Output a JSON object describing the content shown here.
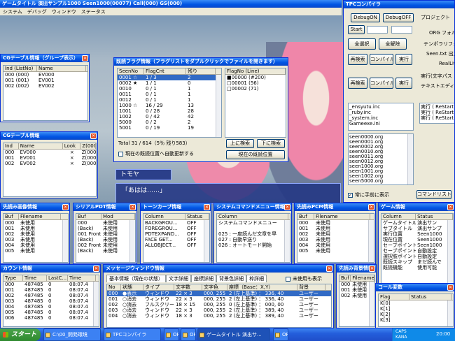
{
  "game": {
    "title": "ゲームタイトル 演出サンプル1000 Seen1000(00077) Call(000) GS(000)",
    "menu": [
      "システム",
      "デバッグ",
      "ウィンドウ",
      "ステータス"
    ],
    "dialog_name": "トモヤ",
    "dialog_text": "「あはは……」"
  },
  "cg_group": {
    "title": "CGテーブル情報（グループ表示）",
    "cols": [
      "Ind (ListNo)",
      "Name"
    ],
    "rows": [
      [
        "000 (000)",
        "EV000"
      ],
      [
        "001 (001)",
        "EV001"
      ],
      [
        "002 (002)",
        "EV002"
      ]
    ]
  },
  "cg_table": {
    "title": "CGテーブル情報",
    "cols": [
      "Ind",
      "Name",
      "Look",
      "Z(000"
    ],
    "rows": [
      [
        "000",
        "EV000",
        "×",
        "Z(000"
      ],
      [
        "001",
        "EV001",
        "×",
        "Z(000"
      ],
      [
        "002",
        "EV002",
        "×",
        "Z(000"
      ]
    ]
  },
  "flag": {
    "title": "既読フラグ情報（フラグリストをダブルクリックでファイルを開きます）",
    "cols": [
      "SeenNo",
      "FlagCnt",
      "残り"
    ],
    "rows": [
      [
        "0001 ☆",
        "1 / 3",
        "2"
      ],
      [
        "0002 ★",
        "1 / 1",
        "0"
      ],
      [
        "0010",
        "0 / 1",
        "1"
      ],
      [
        "0011",
        "0 / 1",
        "1"
      ],
      [
        "0012",
        "0 / 1",
        "1"
      ],
      [
        "1000 ☆",
        "16 / 29",
        "13"
      ],
      [
        "1001",
        "0 / 28",
        "28"
      ],
      [
        "1002",
        "0 / 42",
        "42"
      ],
      [
        "5000",
        "0 / 2",
        "2"
      ],
      [
        "5001",
        "0 / 19",
        "19"
      ]
    ],
    "right_cols": [
      "FlagNo (Line)"
    ],
    "right_rows": [
      "■00000 (#200)",
      "□00001 (56)",
      "□00002 (71)"
    ],
    "total": "Total 31 / 614（5％ 残り583）",
    "btn_up": "上に検索",
    "btn_down": "下に検索",
    "check_label": "現在の既読位置へ自動更新する",
    "btn_current": "現在の既読位置"
  },
  "tpc": {
    "title": "TPCコンパイラ",
    "btn_debug_on": "DebugON",
    "btn_debug_off": "DebugOFF",
    "btn_start": "Start",
    "btn_all_select": "全選択",
    "btn_all_clear": "全解除",
    "btn_research": "再検索",
    "btn_compile": "コンパイル",
    "btn_run": "実行",
    "btn_research2": "再検索",
    "btn_compile2": "コンパイル",
    "btn_run2": "実行",
    "inc_files": [
      "_ensyutu.inc",
      "_ruby.inc",
      "_system.inc",
      "Gameexe.ini"
    ],
    "seen_files": [
      "seen0000.org",
      "seen0001.org",
      "seen0002.org",
      "seen0010.org",
      "seen0011.org",
      "seen0012.org",
      "seen1000.org",
      "seen1001.org",
      "seen1002.org",
      "seen5000.org"
    ],
    "right_labels": [
      "プロジェクト",
      "ORG フォルダ",
      "テンポラリフォルダ",
      "Seen.txt 出力先",
      "RealLive.exe",
      "実行(文字パス",
      "テキストエディタ"
    ],
    "right_list": [
      "実行 ( ReStart",
      "実行 ( ReStart",
      "実行 ( ReStart"
    ],
    "check_top": "常に手前に表示",
    "btn_command": "コマンドリスト"
  },
  "yomi_img": {
    "title": "先読み画像情報",
    "cols": [
      "Buf",
      "Filename"
    ],
    "rows": [
      [
        "000",
        "未使用"
      ],
      [
        "001",
        "未使用"
      ],
      [
        "002",
        "未使用"
      ],
      [
        "003",
        "未使用"
      ],
      [
        "004",
        "未使用"
      ],
      [
        "005",
        "未使用"
      ]
    ]
  },
  "serial": {
    "title": "シリアルPDT情報",
    "cols": [
      "Buf",
      "Mod"
    ],
    "rows": [
      [
        "000",
        "未使用"
      ],
      [
        "(Back)",
        "未使用"
      ],
      [
        "001 Front",
        "未使用"
      ],
      [
        "(Back)",
        "未使用"
      ],
      [
        "002 Front",
        "未使用"
      ],
      [
        "(Back)",
        "未使用"
      ]
    ]
  },
  "token": {
    "title": "トーンカーブ情報",
    "cols": [
      "Column",
      "Status"
    ],
    "rows": [
      [
        "BACKGROU...",
        "OFF"
      ],
      [
        "FOREGROU...",
        "OFF"
      ],
      [
        "PDTEXPAND...",
        "OFF"
      ],
      [
        "FACE GET...",
        "OFF"
      ],
      [
        "ALLOBJECT...",
        "OFF"
      ]
    ]
  },
  "syscmd": {
    "title": "システムコマンドメニュー情報",
    "cols": [
      "Column"
    ],
    "rows": [
      "システムコマンドメニュー",
      "",
      "025 : 一度読んだ文章を早",
      "027 : 自動早送り",
      "026 : オートモード開始"
    ]
  },
  "yomi_pcm": {
    "title": "先読みPCM情報",
    "cols": [
      "Buf",
      "Filename"
    ],
    "rows": [
      [
        "000",
        "未使用"
      ],
      [
        "001",
        "未使用"
      ],
      [
        "002",
        "未使用"
      ],
      [
        "003",
        "未使用"
      ],
      [
        "004",
        "未使用"
      ],
      [
        "005",
        "未使用"
      ]
    ]
  },
  "gameinfo": {
    "title": "ゲーム情報",
    "cols": [
      "Column",
      "Status"
    ],
    "rows": [
      [
        "ゲームタイトル",
        "演出サン"
      ],
      [
        "サブタイトル",
        "演出サンプ"
      ],
      [
        "実行位置",
        "Seen1000"
      ],
      [
        "現在位置",
        "Seen1000"
      ],
      [
        "セーブポイント",
        "Seen1000"
      ],
      [
        "セーブポイントモード",
        "自動設定"
      ],
      [
        "選択肢ポイントモード",
        "自動設定"
      ],
      [
        "既読スキップ",
        "まだ読んで"
      ],
      [
        "既読機能",
        "使用可能"
      ]
    ]
  },
  "count": {
    "title": "カウント情報",
    "cols": [
      "Type",
      "Time",
      "LastC...",
      "Time"
    ],
    "rows": [
      [
        "000",
        "487485",
        "0",
        "08:07.4"
      ],
      [
        "001",
        "487485",
        "0",
        "08:07.4"
      ],
      [
        "002",
        "487485",
        "0",
        "08:07.4"
      ],
      [
        "003",
        "487485",
        "0",
        "08:07.4"
      ],
      [
        "004",
        "487485",
        "0",
        "08:07.4"
      ],
      [
        "005",
        "487485",
        "0",
        "08:07.4"
      ],
      [
        "006",
        "487485",
        "0",
        "08:07.4"
      ]
    ]
  },
  "msgwin": {
    "title": "メッセージウィンドウ情報",
    "tabs": [
      "基本情報（現在の状態）",
      "文字詳細",
      "座標詳細",
      "背景色詳細",
      "枠詳細"
    ],
    "check": "未使用も表示",
    "cols": [
      "No",
      "状態",
      "タイプ",
      "文字数",
      "文字色",
      "座標（Base：X,Y）",
      "背景"
    ],
    "rows": [
      [
        "000",
        "●表示",
        "ウィンドウ",
        "22 × 3",
        "000, 255",
        "2 (左上基準) ： 336, 40",
        "ユーザー"
      ],
      [
        "001",
        "○消去",
        "ウィンドウ",
        "22 × 3",
        "000, 255",
        "2 (左上基準) ： 336, 40",
        "ユーザー"
      ],
      [
        "002",
        "○消去",
        "フルスクリーン",
        "18 × 15",
        "000, 255",
        "0 (左上基準) ： 000, 00",
        "ユーザー"
      ],
      [
        "003",
        "○消去",
        "ウィンドウ",
        "22 × 3",
        "000, 255",
        "2 (左上基準) ： 389, 40",
        "ユーザー"
      ],
      [
        "004",
        "○消去",
        "ウィンドウ",
        "18 × 3",
        "000, 255",
        "2 (左上基準) ： 389, 40",
        "ユーザー"
      ]
    ]
  },
  "yomi_bg": {
    "title": "先読み背景情報",
    "cols": [
      "Buf",
      "Filename"
    ],
    "rows": [
      [
        "000",
        "未使用"
      ],
      [
        "001",
        "未使用"
      ],
      [
        "002",
        "未使用"
      ]
    ]
  },
  "call": {
    "title": "コール変数",
    "cols": [
      "Flag",
      "Status"
    ],
    "rows": [
      [
        "K[0]",
        ""
      ],
      [
        "K[1]",
        ""
      ],
      [
        "K[2]",
        ""
      ],
      [
        "K[3]",
        ""
      ]
    ]
  },
  "taskbar": {
    "start": "スタート",
    "items": [
      "C:\\00_開発環境",
      "TPCコンパイラ",
      "OFF",
      "OFF",
      "ゲームタイトル 演出サ...",
      "OFF"
    ],
    "tray": [
      "CAPS",
      "KANA"
    ],
    "clock": "20:00"
  }
}
